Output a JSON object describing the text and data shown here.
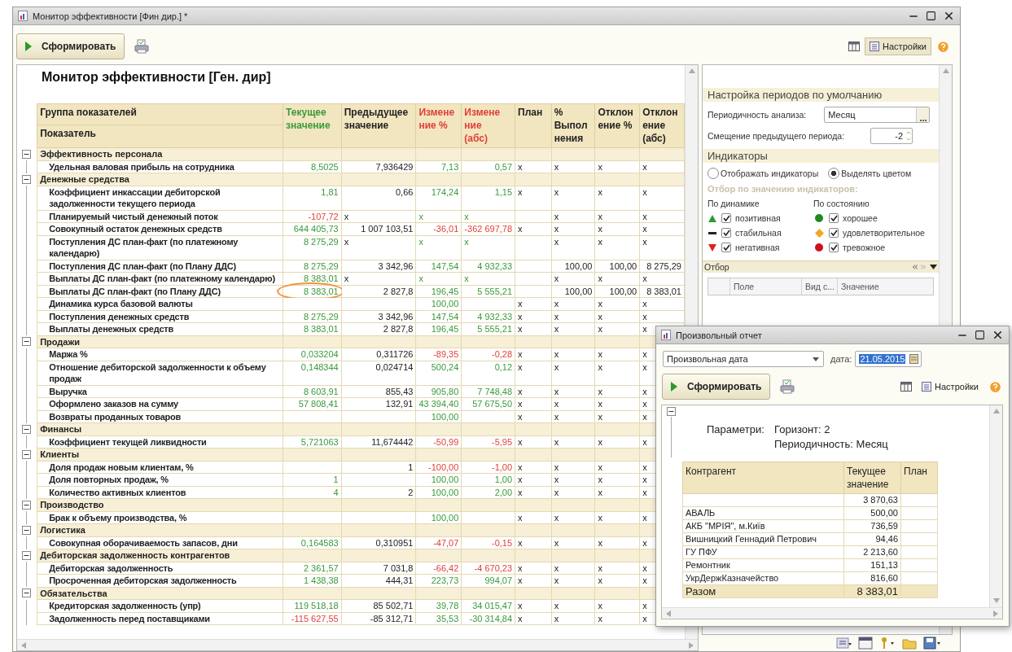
{
  "window": {
    "title": "Монитор эффективности [Фин дир.] *"
  },
  "toolbar": {
    "run_button": "Сформировать",
    "settings_button": "Настройки"
  },
  "report": {
    "title": "Монитор эффективности [Ген. дир]",
    "group_header": "Группа показателей",
    "name_header": "Показатель",
    "columns": [
      {
        "lines": [
          "Текущее",
          "значение"
        ],
        "color": "#3a9a3a"
      },
      {
        "lines": [
          "Предыдущее",
          "значение"
        ],
        "color": "#222222"
      },
      {
        "lines": [
          "Измене",
          "ние %"
        ],
        "color": "#e0403a"
      },
      {
        "lines": [
          "Измене",
          "ние",
          "(абс)"
        ],
        "color": "#e0403a"
      },
      {
        "lines": [
          "План"
        ],
        "color": "#222222"
      },
      {
        "lines": [
          "%",
          "Выпол",
          "нения"
        ],
        "color": "#222222"
      },
      {
        "lines": [
          "Отклон",
          "ение %"
        ],
        "color": "#222222"
      },
      {
        "lines": [
          "Отклон",
          "ение",
          "(абс)"
        ],
        "color": "#222222"
      }
    ],
    "rows": [
      {
        "kind": "group",
        "name": "Эффективность персонала",
        "expanded": true
      },
      {
        "kind": "item",
        "name": "Удельная валовая прибыль на сотрудника",
        "cells": [
          {
            "text": "8,5025",
            "kind": "gain"
          },
          {
            "text": "7,936429",
            "kind": "value"
          },
          {
            "text": "7,13",
            "kind": "gain"
          },
          {
            "text": "0,57",
            "kind": "gain"
          },
          {
            "text": "x",
            "kind": "mark"
          },
          {
            "text": "x",
            "kind": "mark"
          },
          {
            "text": "x",
            "kind": "mark"
          },
          {
            "text": "x",
            "kind": "mark"
          }
        ]
      },
      {
        "kind": "group",
        "name": "Денежные средства",
        "expanded": true
      },
      {
        "kind": "item",
        "name": "Коэффициент инкассации дебиторской задолженности текущего периода",
        "cells": [
          {
            "text": "1,81",
            "kind": "gain"
          },
          {
            "text": "0,66",
            "kind": "value"
          },
          {
            "text": "174,24",
            "kind": "gain"
          },
          {
            "text": "1,15",
            "kind": "gain"
          },
          {
            "text": "x",
            "kind": "mark"
          },
          {
            "text": "x",
            "kind": "mark"
          },
          {
            "text": "x",
            "kind": "mark"
          },
          {
            "text": "x",
            "kind": "mark"
          }
        ]
      },
      {
        "kind": "item",
        "name": "Планируемый чистый денежный поток",
        "cells": [
          {
            "text": "-107,72",
            "kind": "loss"
          },
          {
            "text": "x",
            "kind": "mark"
          },
          {
            "text": "x",
            "kind": "gainmark"
          },
          {
            "text": "x",
            "kind": "gainmark"
          },
          null,
          {
            "text": "x",
            "kind": "mark"
          },
          {
            "text": "x",
            "kind": "mark"
          },
          {
            "text": "x",
            "kind": "mark"
          }
        ]
      },
      {
        "kind": "item",
        "name": "Совокупный остаток денежных средств",
        "cells": [
          {
            "text": "644 405,73",
            "kind": "gain"
          },
          {
            "text": "1 007 103,51",
            "kind": "value"
          },
          {
            "text": "-36,01",
            "kind": "loss"
          },
          {
            "text": "-362 697,78",
            "kind": "loss"
          },
          {
            "text": "x",
            "kind": "mark"
          },
          {
            "text": "x",
            "kind": "mark"
          },
          {
            "text": "x",
            "kind": "mark"
          },
          {
            "text": "x",
            "kind": "mark"
          }
        ]
      },
      {
        "kind": "item",
        "name": "Поступления ДС план-факт (по платежному календарю)",
        "cells": [
          {
            "text": "8 275,29",
            "kind": "gain"
          },
          {
            "text": "x",
            "kind": "mark"
          },
          {
            "text": "x",
            "kind": "gainmark"
          },
          {
            "text": "x",
            "kind": "gainmark"
          },
          null,
          {
            "text": "x",
            "kind": "mark"
          },
          {
            "text": "x",
            "kind": "mark"
          },
          {
            "text": "x",
            "kind": "mark"
          }
        ]
      },
      {
        "kind": "item",
        "name": "Поступления ДС план-факт (по Плану ДДС)",
        "cells": [
          {
            "text": "8 275,29",
            "kind": "gain"
          },
          {
            "text": "3 342,96",
            "kind": "value"
          },
          {
            "text": "147,54",
            "kind": "gain"
          },
          {
            "text": "4 932,33",
            "kind": "gain"
          },
          null,
          {
            "text": "100,00",
            "kind": "value"
          },
          {
            "text": "100,00",
            "kind": "value"
          },
          {
            "text": "8 275,29",
            "kind": "value"
          }
        ]
      },
      {
        "kind": "item",
        "name": "Выплаты ДС план-факт (по платежному календарю)",
        "cells": [
          {
            "text": "8 383,01",
            "kind": "gain"
          },
          {
            "text": "x",
            "kind": "mark"
          },
          {
            "text": "x",
            "kind": "gainmark"
          },
          {
            "text": "x",
            "kind": "gainmark"
          },
          null,
          {
            "text": "x",
            "kind": "mark"
          },
          {
            "text": "x",
            "kind": "mark"
          },
          {
            "text": "x",
            "kind": "mark"
          }
        ]
      },
      {
        "kind": "item",
        "name": "Выплаты ДС план-факт (по Плану ДДС)",
        "cells": [
          {
            "text": "8 383,01",
            "kind": "gain",
            "circled": true
          },
          {
            "text": "2 827,8",
            "kind": "value"
          },
          {
            "text": "196,45",
            "kind": "gain"
          },
          {
            "text": "5 555,21",
            "kind": "gain"
          },
          null,
          {
            "text": "100,00",
            "kind": "value"
          },
          {
            "text": "100,00",
            "kind": "value"
          },
          {
            "text": "8 383,01",
            "kind": "value"
          }
        ]
      },
      {
        "kind": "item",
        "name": "Динамика курса базовой валюты",
        "cells": [
          null,
          null,
          {
            "text": "100,00",
            "kind": "gain"
          },
          null,
          {
            "text": "x",
            "kind": "mark"
          },
          {
            "text": "x",
            "kind": "mark"
          },
          {
            "text": "x",
            "kind": "mark"
          },
          {
            "text": "x",
            "kind": "mark"
          }
        ]
      },
      {
        "kind": "item",
        "name": "Поступления денежных средств",
        "cells": [
          {
            "text": "8 275,29",
            "kind": "gain"
          },
          {
            "text": "3 342,96",
            "kind": "value"
          },
          {
            "text": "147,54",
            "kind": "gain"
          },
          {
            "text": "4 932,33",
            "kind": "gain"
          },
          {
            "text": "x",
            "kind": "mark"
          },
          {
            "text": "x",
            "kind": "mark"
          },
          {
            "text": "x",
            "kind": "mark"
          },
          {
            "text": "x",
            "kind": "mark"
          }
        ]
      },
      {
        "kind": "item",
        "name": "Выплаты денежных средств",
        "cells": [
          {
            "text": "8 383,01",
            "kind": "gain"
          },
          {
            "text": "2 827,8",
            "kind": "value"
          },
          {
            "text": "196,45",
            "kind": "gain"
          },
          {
            "text": "5 555,21",
            "kind": "gain"
          },
          {
            "text": "x",
            "kind": "mark"
          },
          {
            "text": "x",
            "kind": "mark"
          },
          {
            "text": "x",
            "kind": "mark"
          },
          {
            "text": "x",
            "kind": "mark"
          }
        ]
      },
      {
        "kind": "group",
        "name": "Продажи",
        "expanded": true
      },
      {
        "kind": "item",
        "name": "Маржа %",
        "cells": [
          {
            "text": "0,033204",
            "kind": "gain"
          },
          {
            "text": "0,311726",
            "kind": "value"
          },
          {
            "text": "-89,35",
            "kind": "loss"
          },
          {
            "text": "-0,28",
            "kind": "loss"
          },
          {
            "text": "x",
            "kind": "mark"
          },
          {
            "text": "x",
            "kind": "mark"
          },
          {
            "text": "x",
            "kind": "mark"
          },
          {
            "text": "x",
            "kind": "mark"
          }
        ]
      },
      {
        "kind": "item",
        "name": "Отношение дебиторской задолженности к объему продаж",
        "cells": [
          {
            "text": "0,148344",
            "kind": "gain"
          },
          {
            "text": "0,024714",
            "kind": "value"
          },
          {
            "text": "500,24",
            "kind": "gain"
          },
          {
            "text": "0,12",
            "kind": "gain"
          },
          {
            "text": "x",
            "kind": "mark"
          },
          {
            "text": "x",
            "kind": "mark"
          },
          {
            "text": "x",
            "kind": "mark"
          },
          {
            "text": "x",
            "kind": "mark"
          }
        ]
      },
      {
        "kind": "item",
        "name": "Выручка",
        "cells": [
          {
            "text": "8 603,91",
            "kind": "gain"
          },
          {
            "text": "855,43",
            "kind": "value"
          },
          {
            "text": "905,80",
            "kind": "gain"
          },
          {
            "text": "7 748,48",
            "kind": "gain"
          },
          {
            "text": "x",
            "kind": "mark"
          },
          {
            "text": "x",
            "kind": "mark"
          },
          {
            "text": "x",
            "kind": "mark"
          },
          {
            "text": "x",
            "kind": "mark"
          }
        ]
      },
      {
        "kind": "item",
        "name": "Оформлено заказов на сумму",
        "cells": [
          {
            "text": "57 808,41",
            "kind": "gain"
          },
          {
            "text": "132,91",
            "kind": "value"
          },
          {
            "text": "43 394,40",
            "kind": "gain"
          },
          {
            "text": "57 675,50",
            "kind": "gain"
          },
          {
            "text": "x",
            "kind": "mark"
          },
          {
            "text": "x",
            "kind": "mark"
          },
          {
            "text": "x",
            "kind": "mark"
          },
          {
            "text": "x",
            "kind": "mark"
          }
        ]
      },
      {
        "kind": "item",
        "name": "Возвраты проданных товаров",
        "cells": [
          null,
          null,
          {
            "text": "100,00",
            "kind": "gain"
          },
          null,
          {
            "text": "x",
            "kind": "mark"
          },
          {
            "text": "x",
            "kind": "mark"
          },
          {
            "text": "x",
            "kind": "mark"
          },
          {
            "text": "x",
            "kind": "mark"
          }
        ]
      },
      {
        "kind": "group",
        "name": "Финансы",
        "expanded": true
      },
      {
        "kind": "item",
        "name": "Коэффициент текущей ликвидности",
        "cells": [
          {
            "text": "5,721063",
            "kind": "gain"
          },
          {
            "text": "11,674442",
            "kind": "value"
          },
          {
            "text": "-50,99",
            "kind": "loss"
          },
          {
            "text": "-5,95",
            "kind": "loss"
          },
          {
            "text": "x",
            "kind": "mark"
          },
          {
            "text": "x",
            "kind": "mark"
          },
          {
            "text": "x",
            "kind": "mark"
          },
          {
            "text": "x",
            "kind": "mark"
          }
        ]
      },
      {
        "kind": "group",
        "name": "Клиенты",
        "expanded": true
      },
      {
        "kind": "item",
        "name": "Доля продаж новым клиентам, %",
        "cells": [
          null,
          {
            "text": "1",
            "kind": "value"
          },
          {
            "text": "-100,00",
            "kind": "loss"
          },
          {
            "text": "-1,00",
            "kind": "loss"
          },
          {
            "text": "x",
            "kind": "mark"
          },
          {
            "text": "x",
            "kind": "mark"
          },
          {
            "text": "x",
            "kind": "mark"
          },
          {
            "text": "x",
            "kind": "mark"
          }
        ]
      },
      {
        "kind": "item",
        "name": "Доля повторных продаж, %",
        "cells": [
          {
            "text": "1",
            "kind": "gain"
          },
          null,
          {
            "text": "100,00",
            "kind": "gain"
          },
          {
            "text": "1,00",
            "kind": "gain"
          },
          {
            "text": "x",
            "kind": "mark"
          },
          {
            "text": "x",
            "kind": "mark"
          },
          {
            "text": "x",
            "kind": "mark"
          },
          {
            "text": "x",
            "kind": "mark"
          }
        ]
      },
      {
        "kind": "item",
        "name": "Количество активных клиентов",
        "cells": [
          {
            "text": "4",
            "kind": "gain"
          },
          {
            "text": "2",
            "kind": "value"
          },
          {
            "text": "100,00",
            "kind": "gain"
          },
          {
            "text": "2,00",
            "kind": "gain"
          },
          {
            "text": "x",
            "kind": "mark"
          },
          {
            "text": "x",
            "kind": "mark"
          },
          {
            "text": "x",
            "kind": "mark"
          },
          {
            "text": "x",
            "kind": "mark"
          }
        ]
      },
      {
        "kind": "group",
        "name": "Производство",
        "expanded": true
      },
      {
        "kind": "item",
        "name": "Брак к объему производства, %",
        "cells": [
          null,
          null,
          {
            "text": "100,00",
            "kind": "gain"
          },
          null,
          {
            "text": "x",
            "kind": "mark"
          },
          {
            "text": "x",
            "kind": "mark"
          },
          {
            "text": "x",
            "kind": "mark"
          },
          {
            "text": "x",
            "kind": "mark"
          }
        ]
      },
      {
        "kind": "group",
        "name": "Логистика",
        "expanded": true
      },
      {
        "kind": "item",
        "name": "Совокупная оборачиваемость запасов, дни",
        "cells": [
          {
            "text": "0,164583",
            "kind": "gain"
          },
          {
            "text": "0,310951",
            "kind": "value"
          },
          {
            "text": "-47,07",
            "kind": "loss"
          },
          {
            "text": "-0,15",
            "kind": "loss"
          },
          {
            "text": "x",
            "kind": "mark"
          },
          {
            "text": "x",
            "kind": "mark"
          },
          {
            "text": "x",
            "kind": "mark"
          },
          {
            "text": "x",
            "kind": "mark"
          }
        ]
      },
      {
        "kind": "group",
        "name": "Дебиторская задолженность контрагентов",
        "expanded": true
      },
      {
        "kind": "item",
        "name": "Дебиторская задолженность",
        "cells": [
          {
            "text": "2 361,57",
            "kind": "gain"
          },
          {
            "text": "7 031,8",
            "kind": "value"
          },
          {
            "text": "-66,42",
            "kind": "loss"
          },
          {
            "text": "-4 670,23",
            "kind": "loss"
          },
          {
            "text": "x",
            "kind": "mark"
          },
          {
            "text": "x",
            "kind": "mark"
          },
          {
            "text": "x",
            "kind": "mark"
          },
          {
            "text": "x",
            "kind": "mark"
          }
        ]
      },
      {
        "kind": "item",
        "name": "Просроченная дебиторская задолженность",
        "cells": [
          {
            "text": "1 438,38",
            "kind": "gain"
          },
          {
            "text": "444,31",
            "kind": "value"
          },
          {
            "text": "223,73",
            "kind": "gain"
          },
          {
            "text": "994,07",
            "kind": "gain"
          },
          {
            "text": "x",
            "kind": "mark"
          },
          {
            "text": "x",
            "kind": "mark"
          },
          {
            "text": "x",
            "kind": "mark"
          },
          {
            "text": "x",
            "kind": "mark"
          }
        ]
      },
      {
        "kind": "group",
        "name": "Обязательства",
        "expanded": true
      },
      {
        "kind": "item",
        "name": "Кредиторская задолженность (упр)",
        "cells": [
          {
            "text": "119 518,18",
            "kind": "gain"
          },
          {
            "text": "85 502,71",
            "kind": "value"
          },
          {
            "text": "39,78",
            "kind": "gain"
          },
          {
            "text": "34 015,47",
            "kind": "gain"
          },
          {
            "text": "x",
            "kind": "mark"
          },
          {
            "text": "x",
            "kind": "mark"
          },
          {
            "text": "x",
            "kind": "mark"
          },
          {
            "text": "x",
            "kind": "mark"
          }
        ]
      },
      {
        "kind": "item",
        "name": "Задолженность перед поставщиками",
        "cells": [
          {
            "text": "-115 627,55",
            "kind": "loss"
          },
          {
            "text": "-85 312,71",
            "kind": "value"
          },
          {
            "text": "35,53",
            "kind": "gain"
          },
          {
            "text": "-30 314,84",
            "kind": "gain"
          },
          {
            "text": "x",
            "kind": "mark"
          },
          {
            "text": "x",
            "kind": "mark"
          },
          {
            "text": "x",
            "kind": "mark"
          },
          {
            "text": "x",
            "kind": "mark"
          }
        ]
      }
    ]
  },
  "settings": {
    "defaults": {
      "title": "Настройка периодов по умолчанию",
      "period_label": "Периодичность анализа:",
      "period_value": "Месяц",
      "offset_label": "Смещение предыдущего периода:",
      "offset_value": "-2"
    },
    "indicators": {
      "title": "Индикаторы",
      "modes": [
        {
          "label": "Отображать индикаторы",
          "selected": false
        },
        {
          "label": "Выделять цветом",
          "selected": true
        }
      ],
      "filter_title": "Отбор по значению индикаторов:",
      "dynamics": {
        "title": "По динамике",
        "items": [
          {
            "kind": "up",
            "color": "#2e9a2e",
            "label": "позитивная",
            "checked": true
          },
          {
            "kind": "flat",
            "color": "#222222",
            "label": "стабильная",
            "checked": true
          },
          {
            "kind": "down",
            "color": "#e02020",
            "label": "негативная",
            "checked": true
          }
        ]
      },
      "state": {
        "title": "По состоянию",
        "items": [
          {
            "kind": "circle",
            "color": "#1f8a1f",
            "label": "хорошее",
            "checked": true
          },
          {
            "kind": "diamond",
            "color": "#f5a623",
            "label": "удовлетворительное",
            "checked": true
          },
          {
            "kind": "circle",
            "color": "#d0101a",
            "label": "тревожное",
            "checked": true
          }
        ]
      }
    },
    "filter": {
      "title": "Отбор",
      "columns": [
        "Поле",
        "Вид с...",
        "Значение"
      ]
    }
  },
  "popup": {
    "title": "Произвольный отчет",
    "period": "Произвольная дата",
    "date_label": "дата:",
    "date_value": "21.05.2015",
    "date_highlighted": true,
    "run_button": "Сформировать",
    "settings_button": "Настройки",
    "expanded": true,
    "params_label": "Параметри:",
    "params": [
      "Горизонт: 2",
      "Периодичность: Месяц"
    ],
    "columns": [
      {
        "lines": [
          "Контрагент"
        ]
      },
      {
        "lines": [
          "Текущее",
          "значение"
        ]
      },
      {
        "lines": [
          "План"
        ]
      }
    ],
    "rows": [
      {
        "value": "3 870,63"
      },
      {
        "name": "АВАЛЬ",
        "value": "500,00"
      },
      {
        "name": "АКБ \"МРІЯ\", м.Київ",
        "value": "736,59"
      },
      {
        "name": "Вишницкий Геннадий Петрович",
        "value": "94,46"
      },
      {
        "name": "ГУ ПФУ",
        "value": "2 213,60"
      },
      {
        "name": "Ремонтник",
        "value": "151,13"
      },
      {
        "name": "УкрДержКазначейство",
        "value": "816,60"
      }
    ],
    "total": {
      "label": "Разом",
      "value": "8 383,01"
    }
  }
}
